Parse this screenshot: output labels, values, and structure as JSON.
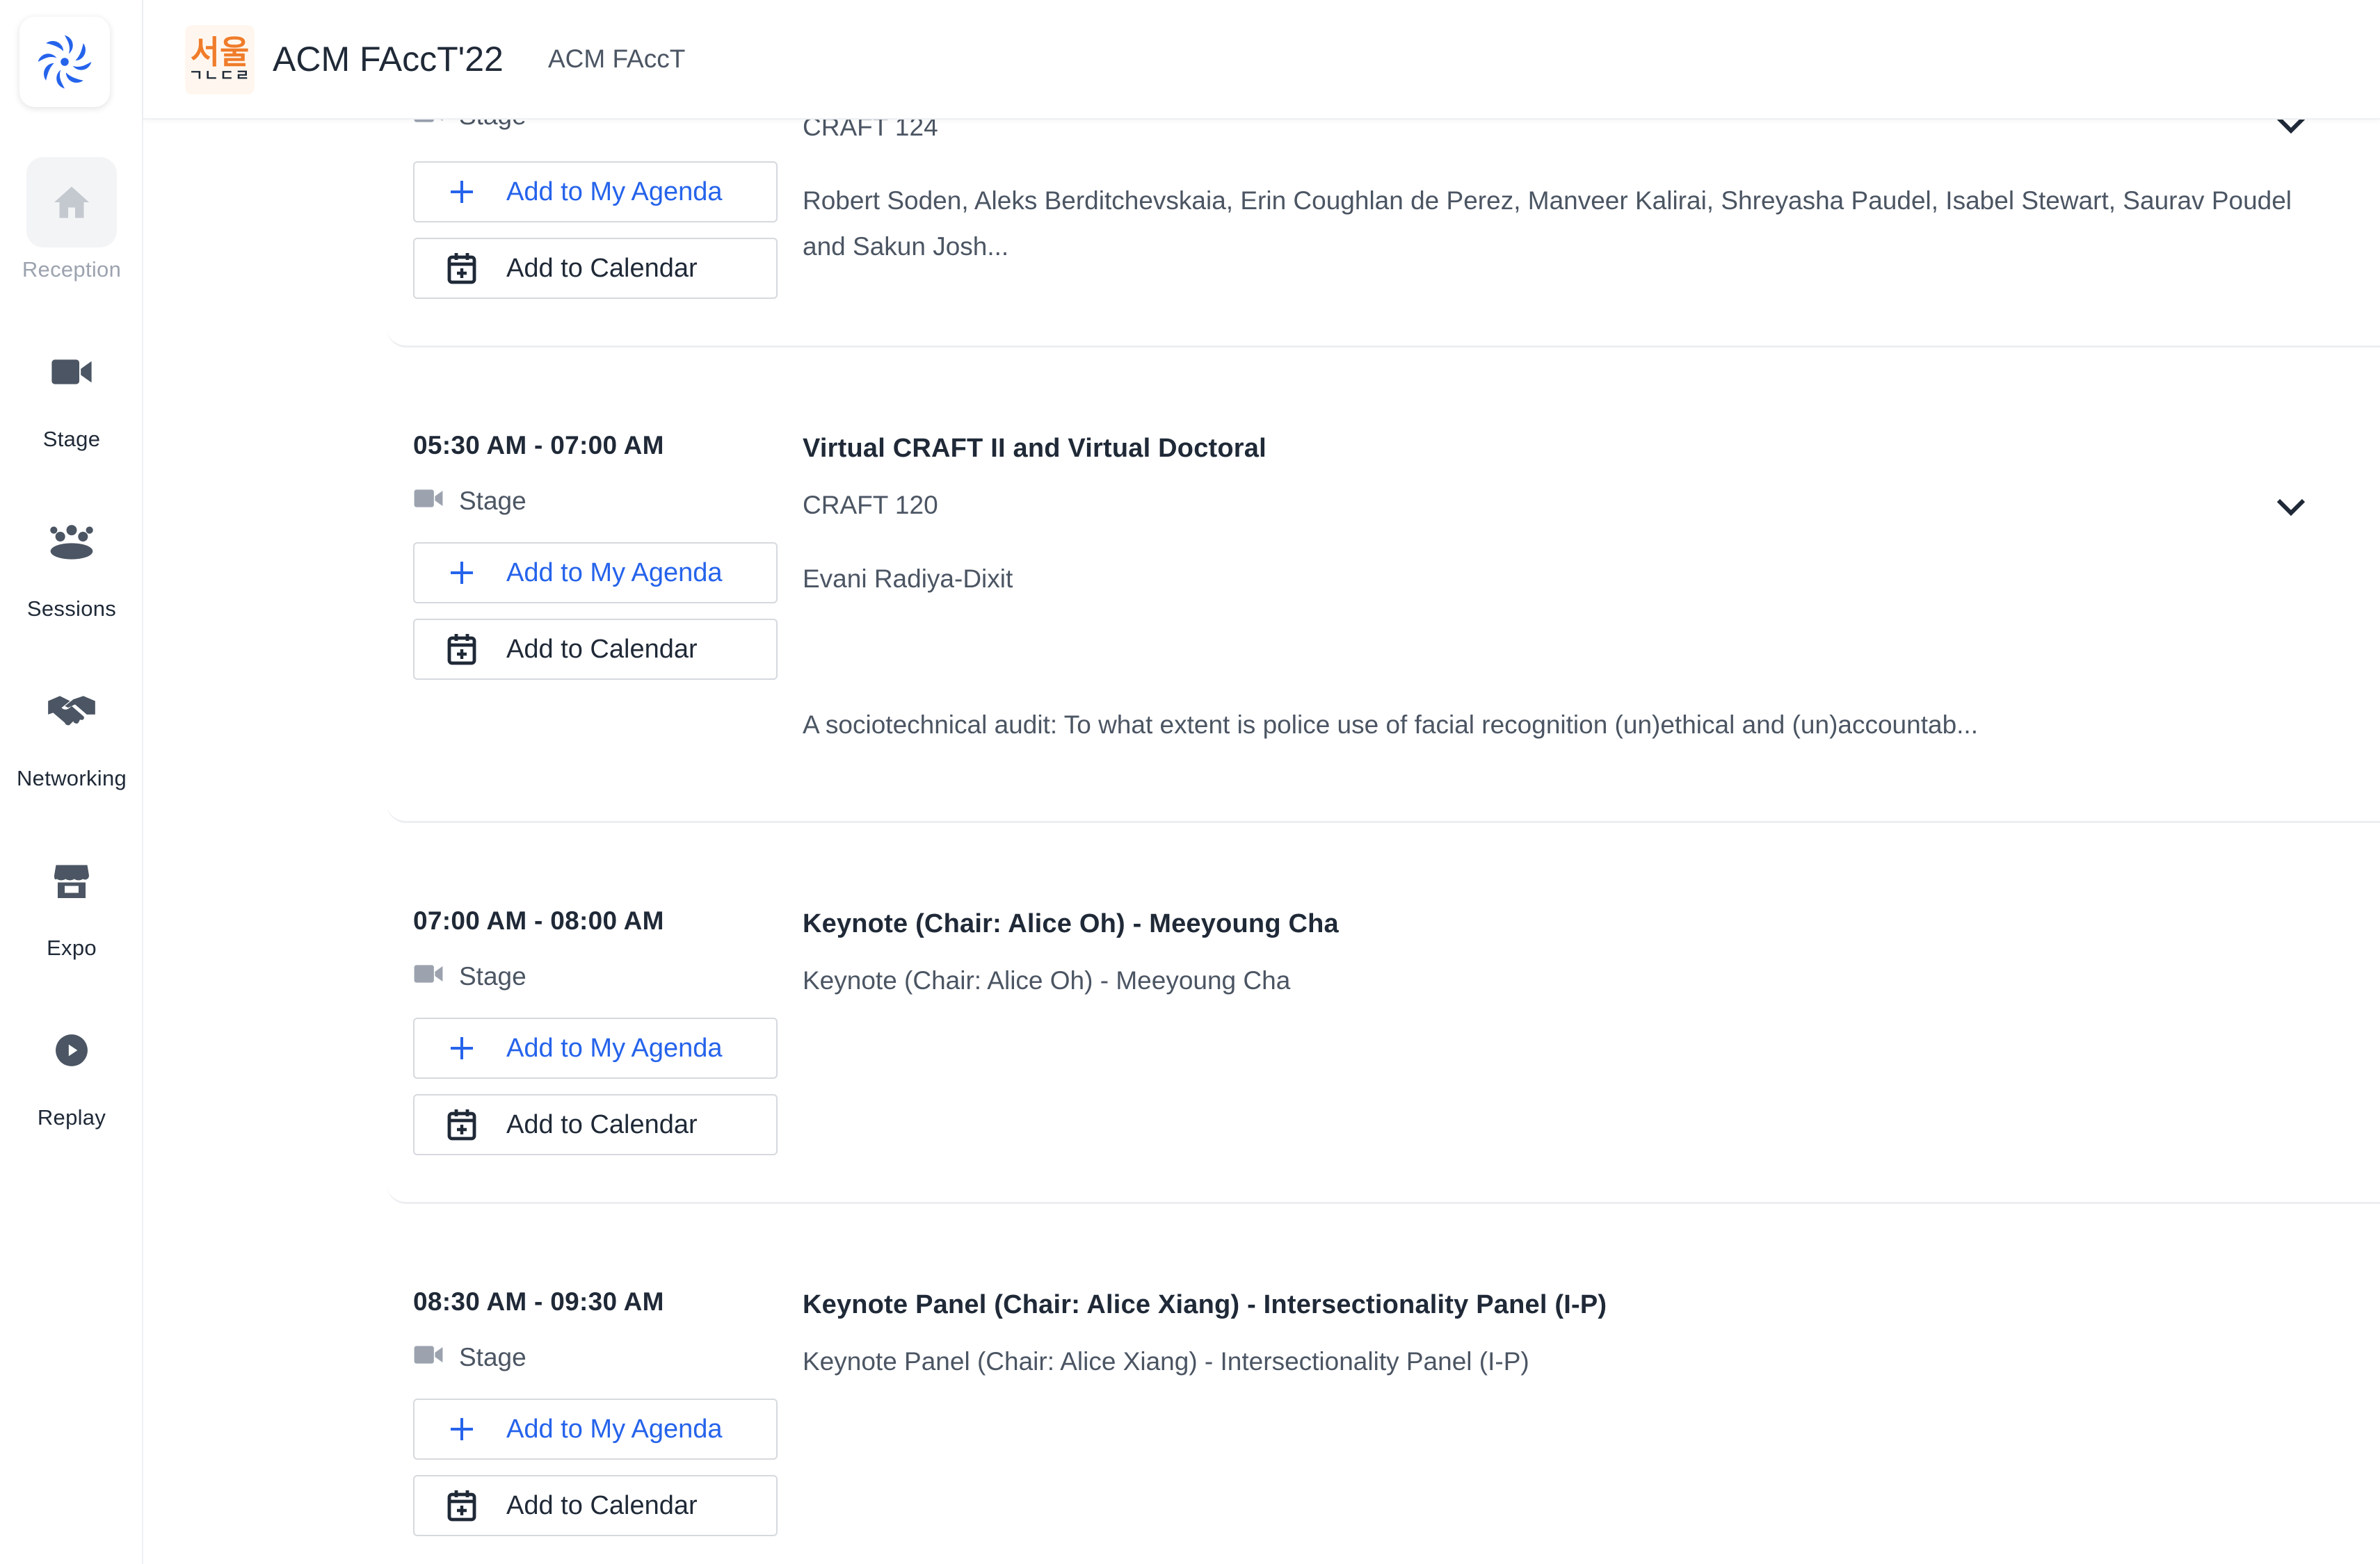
{
  "sidebar": {
    "items": [
      {
        "label": "Reception",
        "icon": "home-icon",
        "active": true
      },
      {
        "label": "Stage",
        "icon": "video-camera-icon"
      },
      {
        "label": "Sessions",
        "icon": "people-group-icon"
      },
      {
        "label": "Networking",
        "icon": "handshake-icon"
      },
      {
        "label": "Expo",
        "icon": "storefront-icon"
      },
      {
        "label": "Replay",
        "icon": "play-circle-icon"
      }
    ]
  },
  "header": {
    "logo_text_top": "서울",
    "logo_text_bottom": "ㄱㄴㄷㄹ",
    "title": "ACM FAccT'22",
    "subtitle": "ACM FAccT"
  },
  "buttons": {
    "add_agenda": "Add to My Agenda",
    "add_calendar": "Add to Calendar"
  },
  "sessions": [
    {
      "time": "",
      "location": "Stage",
      "title": "",
      "code": "CRAFT 124",
      "speakers": "Robert Soden, Aleks Berditchevskaia, Erin Coughlan de Perez, Manveer Kalirai, Shreyasha Paudel, Isabel Stewart, Saurav Poudel and Sakun Josh...",
      "description": ""
    },
    {
      "time": "05:30 AM - 07:00 AM",
      "location": "Stage",
      "title": "Virtual CRAFT II and Virtual Doctoral",
      "code": "CRAFT 120",
      "speakers": "Evani Radiya-Dixit",
      "description": "A sociotechnical audit: To what extent is police use of facial recognition (un)ethical and (un)accountab..."
    },
    {
      "time": "07:00 AM - 08:00 AM",
      "location": "Stage",
      "title": "Keynote (Chair: Alice Oh) - Meeyoung Cha",
      "code": "Keynote (Chair: Alice Oh) - Meeyoung Cha",
      "speakers": "",
      "description": ""
    },
    {
      "time": "08:30 AM - 09:30 AM",
      "location": "Stage",
      "title": "Keynote Panel (Chair: Alice Xiang) - Intersectionality Panel (I-P)",
      "code": "Keynote Panel (Chair: Alice Xiang) - Intersectionality Panel (I-P)",
      "speakers": "",
      "description": ""
    }
  ],
  "colors": {
    "accent": "#2563eb",
    "text": "#1f2937",
    "muted": "#4b5563",
    "icon": "#4b5563"
  }
}
